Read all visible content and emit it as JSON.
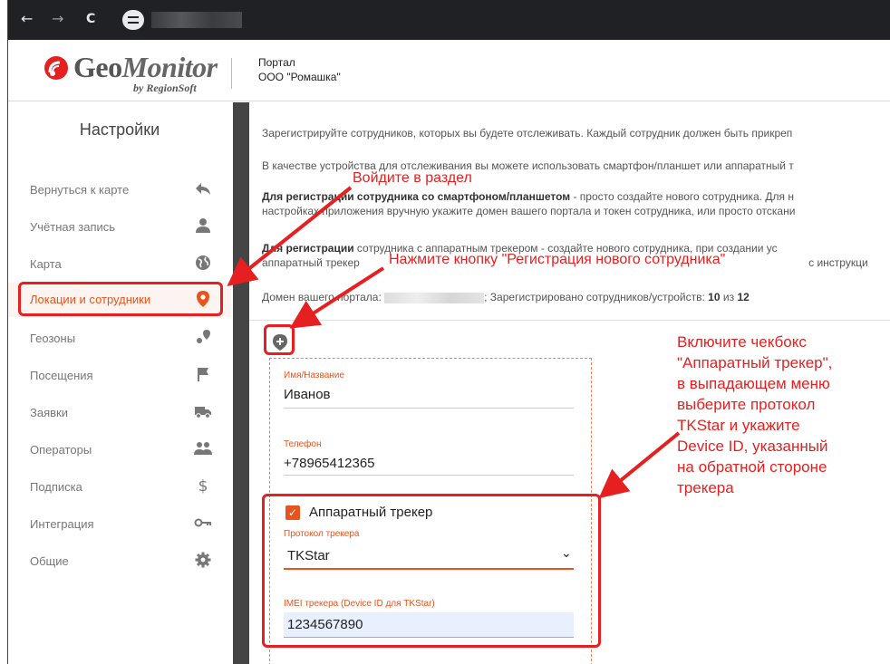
{
  "browser": {
    "back_icon": "←",
    "forward_icon": "→",
    "reload_icon": "C"
  },
  "header": {
    "logo_geo": "Geo",
    "logo_monitor": "Monitor",
    "logo_sub": "by RegionSoft",
    "portal_label": "Портал",
    "portal_org": "ООО \"Ромашка\""
  },
  "sidebar": {
    "title": "Настройки",
    "items": [
      {
        "label": "Вернуться к карте",
        "icon": "reply-arrow-icon"
      },
      {
        "label": "Учётная запись",
        "icon": "user-icon"
      },
      {
        "label": "Карта",
        "icon": "globe-icon"
      },
      {
        "label": "Локации и сотрудники",
        "icon": "location-pin-icon",
        "active": true
      },
      {
        "label": "Геозоны",
        "icon": "geozone-icon"
      },
      {
        "label": "Посещения",
        "icon": "flag-icon"
      },
      {
        "label": "Заявки",
        "icon": "truck-icon"
      },
      {
        "label": "Операторы",
        "icon": "users-icon"
      },
      {
        "label": "Подписка",
        "icon": "dollar-icon"
      },
      {
        "label": "Интеграция",
        "icon": "key-icon"
      },
      {
        "label": "Общие",
        "icon": "gear-icon"
      }
    ]
  },
  "main": {
    "intro1": "Зарегистрируйте сотрудников, которых вы будете отслеживать. Каждый сотрудник должен быть прикреп",
    "intro2": "В качестве устройства для отслеживания вы можете использовать смартфон/планшет или аппаратный т",
    "smartphone_bold": "Для регистрации сотрудника со смартфоном/планшетом",
    "smartphone_text": " - просто создайте нового сотрудника. Для н",
    "smartphone_text2": "настройках приложения вручную укажите домен вашего портала и токен сотрудника, или просто отскани",
    "tracker_bold": "Для регистрации",
    "tracker_text": " сотрудника с аппаратным трекером - создайте нового сотрудника, при создании ус",
    "tracker_text2": "аппаратный трекер",
    "tracker_text2_end": " с инструкци",
    "domain_label": "Домен вашего портала:",
    "registered_label": "; Зарегистрировано сотрудников/устройств:",
    "registered_count": "10",
    "registered_of": "из",
    "registered_total": "12"
  },
  "form": {
    "name_label": "Имя/Название",
    "name_value": "Иванов",
    "phone_label": "Телефон",
    "phone_value": "+78965412365",
    "tracker_checkbox_label": "Аппаратный трекер",
    "tracker_checked": true,
    "protocol_label": "Протокол трекера",
    "protocol_value": "TKStar",
    "imei_label": "IMEI трекера (Device ID для TKStar)",
    "imei_value": "1234567890"
  },
  "annotations": {
    "enter_section": "Войдите в раздел",
    "press_button": "Нажмите кнопку \"Регистрация нового сотрудника\"",
    "enable_checkbox": [
      "Включите чекбокс",
      "\"Аппаратный трекер\",",
      "в выпадающем меню",
      "выберите протокол",
      "TKStar и укажите",
      "Device ID, указанный",
      "на обратной стороне",
      "трекера"
    ],
    "accent_color": "#e62020"
  },
  "colors": {
    "brand_orange": "#e8541c",
    "sidebar_strip": "#454545",
    "browser_bar": "#202124"
  }
}
